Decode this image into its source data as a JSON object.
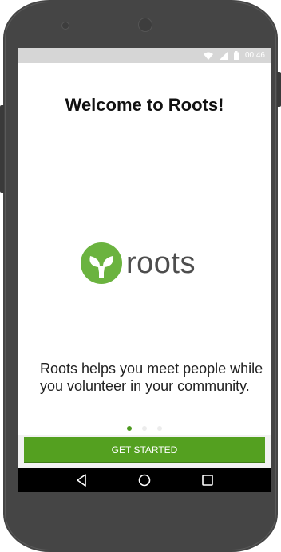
{
  "status_bar": {
    "time": "00:46",
    "icons": [
      "wifi-icon",
      "signal-icon",
      "battery-icon"
    ]
  },
  "welcome": {
    "title": "Welcome to Roots!"
  },
  "logo": {
    "wordmark": "roots",
    "icon": "sprout-icon",
    "brand_color": "#6bb33f"
  },
  "description": "Roots helps you meet people while you volunteer in your community.",
  "pager": {
    "total": 3,
    "active_index": 0
  },
  "cta": {
    "label": "GET STARTED",
    "color": "#54a020"
  },
  "nav_bar": {
    "buttons": [
      "back-icon",
      "home-icon",
      "recents-icon"
    ]
  }
}
